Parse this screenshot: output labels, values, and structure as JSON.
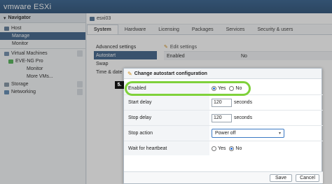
{
  "app": {
    "logo_brand": "vmware",
    "logo_product": " ESXi"
  },
  "navigator": {
    "title": "Navigator",
    "items": [
      {
        "label": "Host"
      },
      {
        "label": "Manage"
      },
      {
        "label": "Monitor"
      },
      {
        "label": "Virtual Machines"
      },
      {
        "label": "EVE-NG Pro"
      },
      {
        "label": "Monitor"
      },
      {
        "label": "More VMs..."
      },
      {
        "label": "Storage"
      },
      {
        "label": "Networking"
      }
    ]
  },
  "main": {
    "title": "esxi03",
    "tabs": [
      {
        "label": "System"
      },
      {
        "label": "Hardware"
      },
      {
        "label": "Licensing"
      },
      {
        "label": "Packages"
      },
      {
        "label": "Services"
      },
      {
        "label": "Security & users"
      }
    ],
    "left_items": [
      {
        "label": "Advanced settings"
      },
      {
        "label": "Autostart"
      },
      {
        "label": "Swap"
      },
      {
        "label": "Time & date"
      }
    ],
    "edit_settings": "Edit settings",
    "enabled_label": "Enabled",
    "enabled_value": "No"
  },
  "dialog": {
    "title": "Change autostart configuration",
    "enabled": {
      "label": "Enabled",
      "yes": "Yes",
      "no": "No",
      "selected": "yes"
    },
    "start_delay": {
      "label": "Start delay",
      "value": "120",
      "unit": "seconds"
    },
    "stop_delay": {
      "label": "Stop delay",
      "value": "120",
      "unit": "seconds"
    },
    "stop_action": {
      "label": "Stop action",
      "value": "Power off"
    },
    "heartbeat": {
      "label": "Wait for heartbeat",
      "yes": "Yes",
      "no": "No",
      "selected": "no"
    },
    "save": "Save",
    "cancel": "Cancel"
  },
  "step_marker": "5.",
  "colors": {
    "highlight": "#7fd13b",
    "selected_nav": "#385d85",
    "topbar": "#2f5c8a"
  }
}
